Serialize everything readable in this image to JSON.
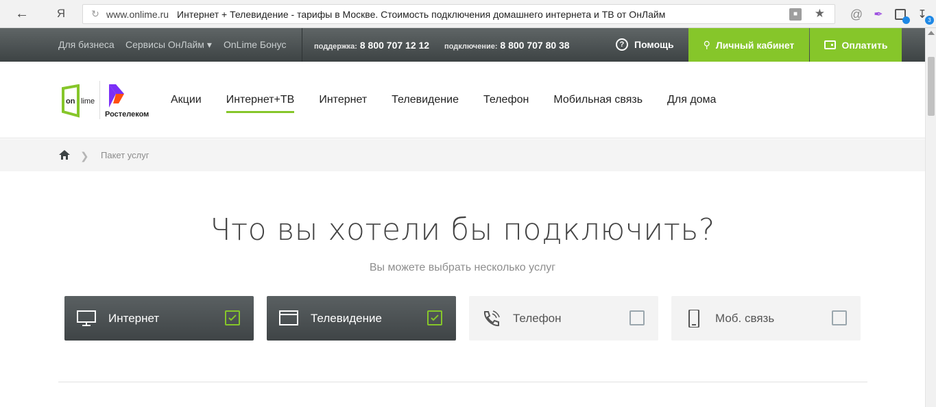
{
  "browser": {
    "back_icon": "back-arrow-icon",
    "ya_label": "Я",
    "url_domain": "www.onlime.ru",
    "url_title": "Интернет + Телевидение - тарифы в Москве. Стоимость подключения домашнего интернета и ТВ от ОнЛайм",
    "download_count": "3"
  },
  "topbar": {
    "business": "Для бизнеса",
    "services": "Сервисы ОнЛайм ▾",
    "bonus": "OnLime Бонус",
    "support_label": "поддержка:",
    "support_phone": "8 800 707 12 12",
    "connect_label": "подключение:",
    "connect_phone": "8 800 707 80 38",
    "help": "Помощь",
    "cabinet": "Личный кабинет",
    "pay": "Оплатить",
    "accent_color": "#86c62a"
  },
  "header": {
    "logo_onlime_text": "on lime",
    "logo_rt_text": "Ростелеком",
    "nav": [
      {
        "label": "Акции"
      },
      {
        "label": "Интернет+ТВ"
      },
      {
        "label": "Интернет"
      },
      {
        "label": "Телевидение"
      },
      {
        "label": "Телефон"
      },
      {
        "label": "Мобильная связь"
      },
      {
        "label": "Для дома"
      }
    ],
    "active_nav": "Интернет+ТВ"
  },
  "breadcrumb": {
    "current": "Пакет услуг"
  },
  "main": {
    "headline": "Что вы хотели бы подключить?",
    "subline": "Вы можете выбрать несколько услуг",
    "services": [
      {
        "label": "Интернет",
        "icon": "monitor-icon",
        "checked": true
      },
      {
        "label": "Телевидение",
        "icon": "tv-window-icon",
        "checked": true
      },
      {
        "label": "Телефон",
        "icon": "phone-icon",
        "checked": false
      },
      {
        "label": "Моб. связь",
        "icon": "smartphone-icon",
        "checked": false
      }
    ]
  }
}
